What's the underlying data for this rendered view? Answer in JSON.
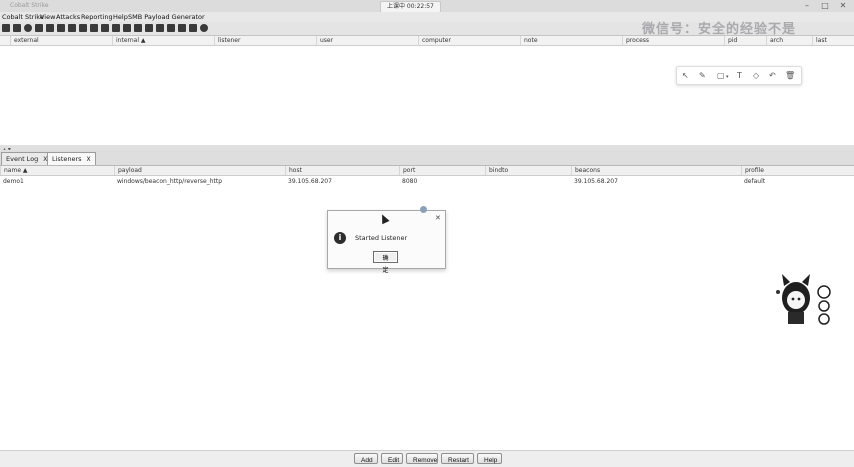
{
  "window": {
    "title": "Cobalt Strike",
    "clock": "上课中 00:22:57",
    "controls": [
      "–",
      "□",
      "✕"
    ]
  },
  "menubar": {
    "items": [
      "Cobalt Strike",
      "View",
      "Attacks",
      "Reporting",
      "Help",
      "SMB Payload Generator"
    ]
  },
  "watermark": "微信号：安全的经验不是",
  "beacons_table": {
    "columns": [
      "external",
      "internal ▲",
      "listener",
      "user",
      "computer",
      "note",
      "process",
      "pid",
      "arch",
      "last"
    ]
  },
  "annotation_toolbar": {
    "icons": [
      "cursor-icon",
      "pen-icon",
      "rect-icon",
      "text-icon",
      "eraser-icon",
      "undo-icon",
      "trash-icon"
    ]
  },
  "tabs": [
    {
      "label": "Event Log",
      "close": "X",
      "active": false
    },
    {
      "label": "Listeners",
      "close": "X",
      "active": true
    }
  ],
  "listeners_table": {
    "columns": [
      "name ▲",
      "payload",
      "host",
      "port",
      "bindto",
      "beacons",
      "profile"
    ],
    "rows": [
      [
        "demo1",
        "windows/beacon_http/reverse_http",
        "39.105.68.207",
        "8080",
        "",
        "39.105.68.207",
        "default"
      ]
    ]
  },
  "dialog": {
    "message": "Started Listener",
    "ok_label": "确定",
    "close": "✕"
  },
  "bottom_buttons": [
    "Add",
    "Edit",
    "Remove",
    "Restart",
    "Help"
  ],
  "colors": {
    "toolbar_bg": "#e4e4e4",
    "dialog_border": "#a8a8a8",
    "accent_dot": "#8aa0b8"
  }
}
